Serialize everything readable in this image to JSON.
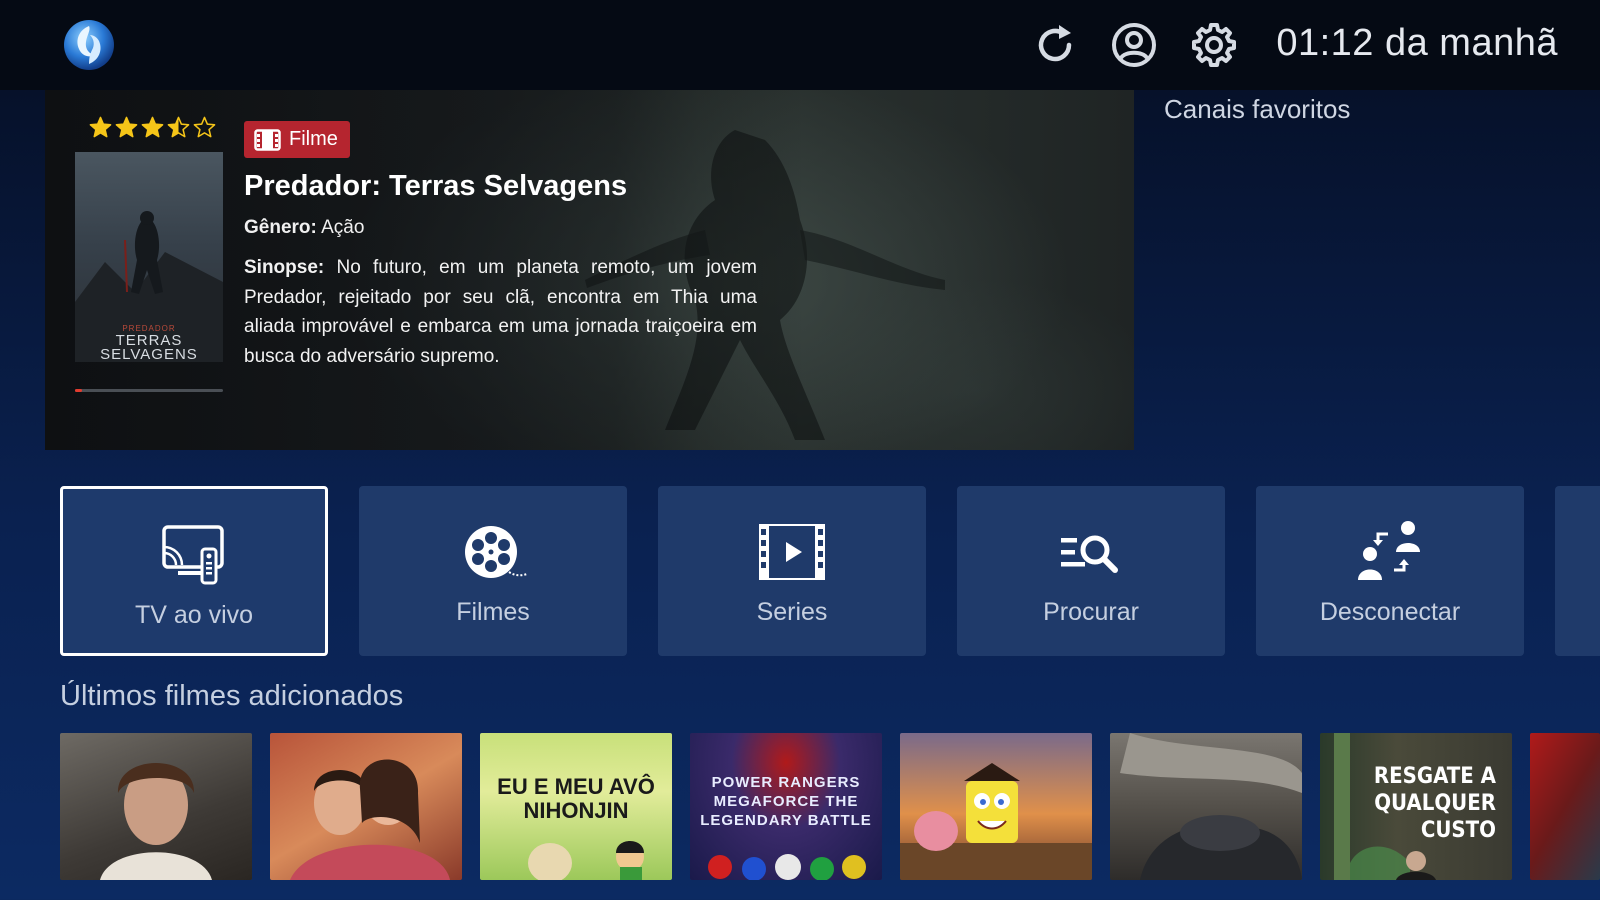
{
  "header": {
    "clock": "01:12 da manhã",
    "icons": [
      "refresh-icon",
      "account-icon",
      "gear-icon"
    ]
  },
  "favorites": {
    "title": "Canais favoritos"
  },
  "featured": {
    "rating_stars": 3.5,
    "rating_max": 5,
    "badge": "Filme",
    "title": "Predador: Terras Selvagens",
    "genre_label": "Gênero:",
    "genre": "Ação",
    "synopsis_label": "Sinopse:",
    "synopsis": "No futuro, em um planeta remoto, um jovem Predador, rejeitado por seu clã, encontra em Thia uma aliada improvável e embarca em uma jornada traiçoeira em busca do adversário supremo.",
    "poster_small_text": "PREDADOR",
    "poster_text": "TERRAS SELVAGENS",
    "progress": 0.05,
    "colors": {
      "badge": "#b5252f",
      "star": "#f5c518",
      "progress": "#e23b2e"
    }
  },
  "menu": [
    {
      "label": "TV ao vivo",
      "icon": "live-tv-icon",
      "active": true
    },
    {
      "label": "Filmes",
      "icon": "film-reel-icon",
      "active": false
    },
    {
      "label": "Series",
      "icon": "play-clapper-icon",
      "active": false
    },
    {
      "label": "Procurar",
      "icon": "search-list-icon",
      "active": false
    },
    {
      "label": "Desconectar",
      "icon": "switch-user-icon",
      "active": false
    }
  ],
  "latest_movies": {
    "title": "Últimos filmes adicionados",
    "items": [
      {
        "poster_text": ""
      },
      {
        "poster_text": ""
      },
      {
        "poster_text": "EU E MEU AVÔ NIHONJIN"
      },
      {
        "poster_text": "POWER RANGERS MEGAFORCE THE LEGENDARY BATTLE"
      },
      {
        "poster_text": ""
      },
      {
        "poster_text": ""
      },
      {
        "poster_text": "RESGATE A QUALQUER CUSTO"
      },
      {
        "poster_text": ""
      }
    ]
  }
}
